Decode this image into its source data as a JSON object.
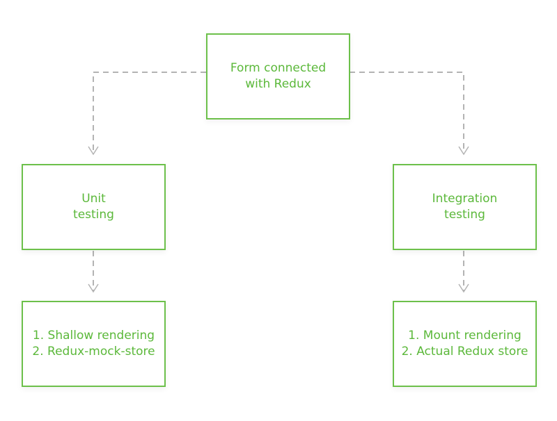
{
  "colors": {
    "node_border": "#6cc04a",
    "node_text": "#5bb83a",
    "connector": "#b3b3b3"
  },
  "diagram": {
    "root": {
      "lines": [
        "Form connected",
        "with Redux"
      ]
    },
    "branches": [
      {
        "id": "unit",
        "title_lines": [
          "Unit",
          "testing"
        ],
        "detail_lines": [
          "1. Shallow rendering",
          "2. Redux-mock-store"
        ]
      },
      {
        "id": "integration",
        "title_lines": [
          "Integration",
          "testing"
        ],
        "detail_lines": [
          "1. Mount rendering",
          "2. Actual Redux store"
        ]
      }
    ],
    "edges": [
      {
        "from": "root",
        "to": "unit",
        "style": "dashed-arrow"
      },
      {
        "from": "root",
        "to": "integration",
        "style": "dashed-arrow"
      },
      {
        "from": "unit",
        "to": "unit-details",
        "style": "dashed-arrow"
      },
      {
        "from": "integration",
        "to": "integration-details",
        "style": "dashed-arrow"
      }
    ]
  }
}
